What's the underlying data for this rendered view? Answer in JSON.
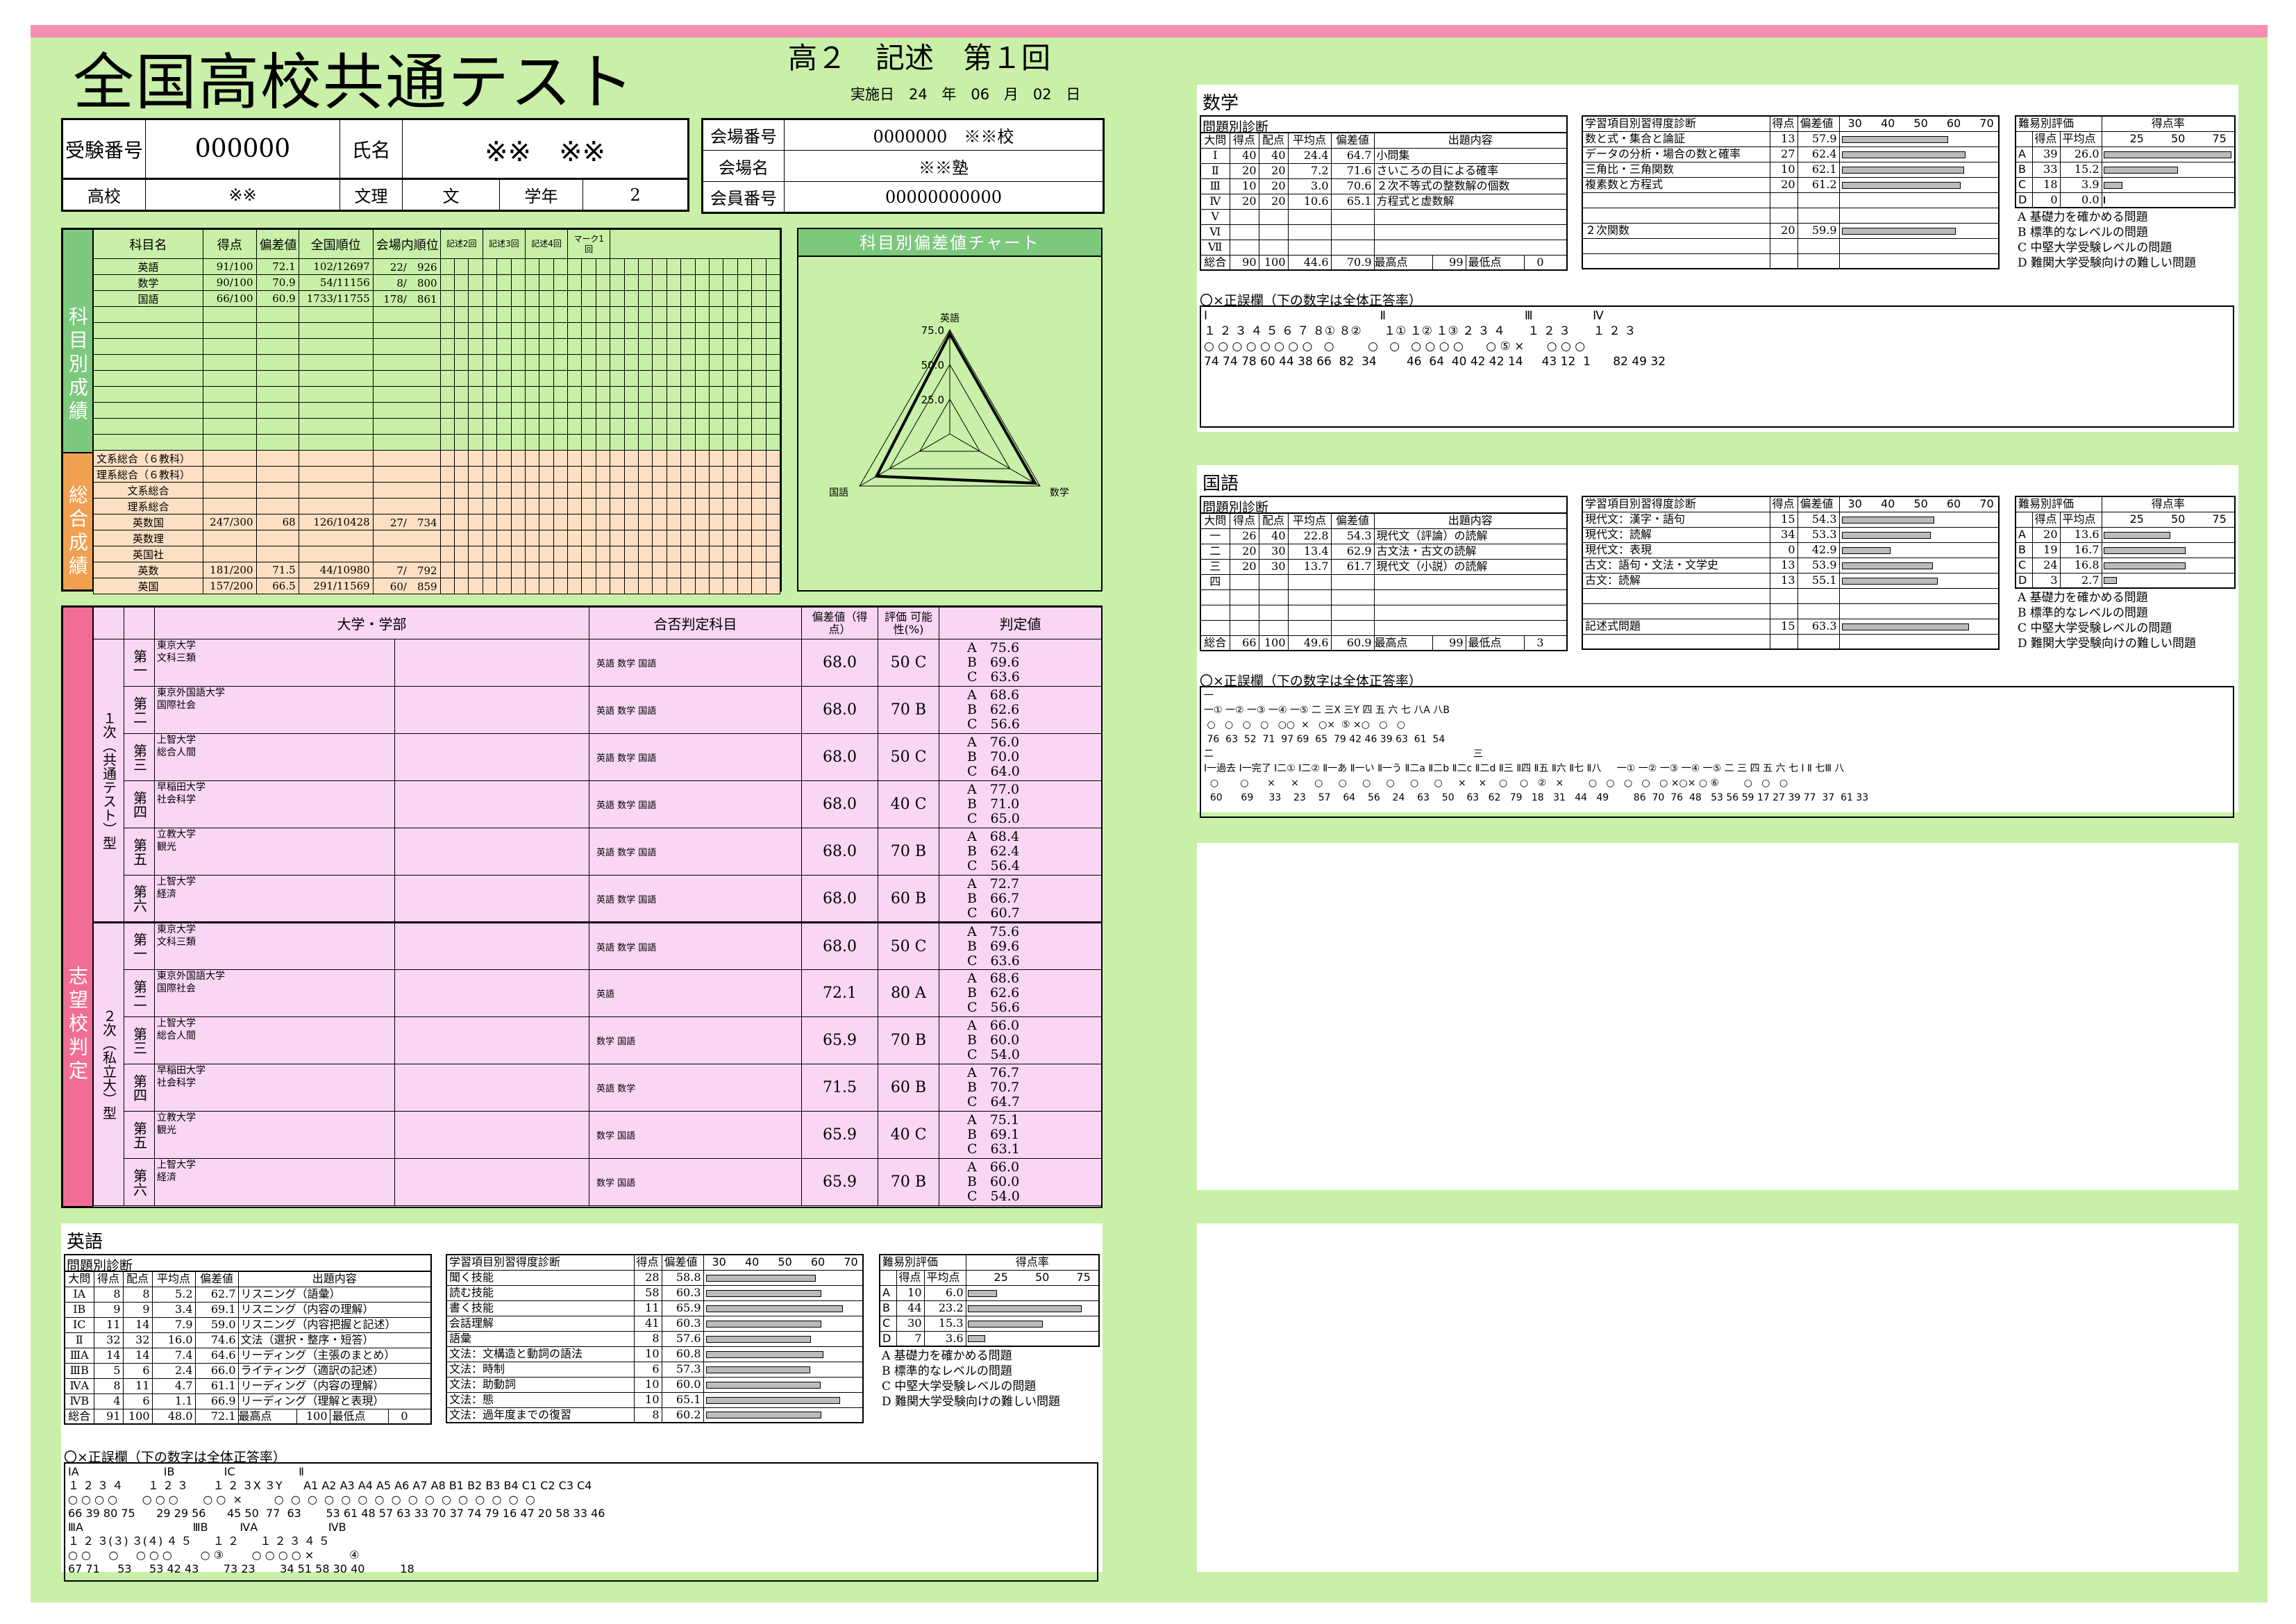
{
  "header": {
    "title": "全国高校共通テスト",
    "exam": "高２　記述　第１回",
    "date_label": "実施日",
    "date_year": "24 年",
    "date_month": "06 月",
    "date_day": "02 日"
  },
  "info": {
    "exam_no_label": "受験番号",
    "exam_no": "000000",
    "name_label": "氏名",
    "name": "※※　※※",
    "school_label": "高校",
    "school": "※※",
    "track_label": "文理",
    "track": "文",
    "grade_label": "学年",
    "grade": "2",
    "venue_no_label": "会場番号",
    "venue_no": "0000000　※※校",
    "venue_name_label": "会場名",
    "venue_name": "※※塾",
    "member_no_label": "会員番号",
    "member_no": "00000000000"
  },
  "scores": {
    "side_label": "科目別成績",
    "total_side_label": "総合成績",
    "headers": [
      "科目名",
      "得点",
      "偏差値",
      "全国順位",
      "会場内順位",
      "記述2回",
      "記述3回",
      "記述4回",
      "マーク1回"
    ],
    "rows": [
      {
        "subject": "英語",
        "score": "91/100",
        "dev": "72.1",
        "rank": "102/12697",
        "venue": "22/　926"
      },
      {
        "subject": "数学",
        "score": "90/100",
        "dev": "70.9",
        "rank": "54/11156",
        "venue": "8/　800"
      },
      {
        "subject": "国語",
        "score": "66/100",
        "dev": "60.9",
        "rank": "1733/11755",
        "venue": "178/　861"
      }
    ],
    "totals": [
      {
        "subject": "文系総合（６教科）",
        "score": "",
        "dev": "",
        "rank": "",
        "venue": ""
      },
      {
        "subject": "理系総合（６教科）",
        "score": "",
        "dev": "",
        "rank": "",
        "venue": ""
      },
      {
        "subject": "文系総合",
        "score": "",
        "dev": "",
        "rank": "",
        "venue": ""
      },
      {
        "subject": "理系総合",
        "score": "",
        "dev": "",
        "rank": "",
        "venue": ""
      },
      {
        "subject": "英数国",
        "score": "247/300",
        "dev": "68",
        "rank": "126/10428",
        "venue": "27/　734"
      },
      {
        "subject": "英数理",
        "score": "",
        "dev": "",
        "rank": "",
        "venue": ""
      },
      {
        "subject": "英国社",
        "score": "",
        "dev": "",
        "rank": "",
        "venue": ""
      },
      {
        "subject": "英数",
        "score": "181/200",
        "dev": "71.5",
        "rank": "44/10980",
        "venue": "7/　792"
      },
      {
        "subject": "英国",
        "score": "157/200",
        "dev": "66.5",
        "rank": "291/11569",
        "venue": "60/　859"
      }
    ]
  },
  "chart": {
    "title": "科目別偏差値チャート",
    "labels": [
      "英語",
      "数学",
      "国語"
    ],
    "ticks": [
      "75.0",
      "50.0",
      "25.0"
    ]
  },
  "chart_data": {
    "type": "radar",
    "categories": [
      "英語",
      "数学",
      "国語"
    ],
    "values": [
      72.1,
      70.9,
      60.9
    ],
    "rlim": [
      0,
      75
    ]
  },
  "judge": {
    "side_label": "志望校判定",
    "headers": [
      "大学・学部",
      "合否判定科目",
      "偏差値（得点）",
      "評価 可能性(%)",
      "判定値"
    ],
    "groups": [
      {
        "label": "１次（共通テスト）型",
        "rows": [
          {
            "rank": "第一",
            "univ": "東京大学",
            "dept": "文科三類",
            "subj": "英語 数学 国語",
            "dev": "68.0",
            "eval": "50 C",
            "j": [
              "A　75.6",
              "B　69.6",
              "C　63.6"
            ]
          },
          {
            "rank": "第二",
            "univ": "東京外国語大学",
            "dept": "国際社会",
            "subj": "英語 数学 国語",
            "dev": "68.0",
            "eval": "70 B",
            "j": [
              "A　68.6",
              "B　62.6",
              "C　56.6"
            ]
          },
          {
            "rank": "第三",
            "univ": "上智大学",
            "dept": "総合人間",
            "subj": "英語 数学 国語",
            "dev": "68.0",
            "eval": "50 C",
            "j": [
              "A　76.0",
              "B　70.0",
              "C　64.0"
            ]
          },
          {
            "rank": "第四",
            "univ": "早稲田大学",
            "dept": "社会科学",
            "subj": "英語 数学 国語",
            "dev": "68.0",
            "eval": "40 C",
            "j": [
              "A　77.0",
              "B　71.0",
              "C　65.0"
            ]
          },
          {
            "rank": "第五",
            "univ": "立教大学",
            "dept": "観光",
            "subj": "英語 数学 国語",
            "dev": "68.0",
            "eval": "70 B",
            "j": [
              "A　68.4",
              "B　62.4",
              "C　56.4"
            ]
          },
          {
            "rank": "第六",
            "univ": "上智大学",
            "dept": "経済",
            "subj": "英語 数学 国語",
            "dev": "68.0",
            "eval": "60 B",
            "j": [
              "A　72.7",
              "B　66.7",
              "C　60.7"
            ]
          }
        ]
      },
      {
        "label": "２次（私立大）型",
        "rows": [
          {
            "rank": "第一",
            "univ": "東京大学",
            "dept": "文科三類",
            "subj": "英語 数学 国語",
            "dev": "68.0",
            "eval": "50 C",
            "j": [
              "A　75.6",
              "B　69.6",
              "C　63.6"
            ]
          },
          {
            "rank": "第二",
            "univ": "東京外国語大学",
            "dept": "国際社会",
            "subj": "英語",
            "dev": "72.1",
            "eval": "80 A",
            "j": [
              "A　68.6",
              "B　62.6",
              "C　56.6"
            ]
          },
          {
            "rank": "第三",
            "univ": "上智大学",
            "dept": "総合人間",
            "subj": "数学 国語",
            "dev": "65.9",
            "eval": "70 B",
            "j": [
              "A　66.0",
              "B　60.0",
              "C　54.0"
            ]
          },
          {
            "rank": "第四",
            "univ": "早稲田大学",
            "dept": "社会科学",
            "subj": "英語 数学",
            "dev": "71.5",
            "eval": "60 B",
            "j": [
              "A　76.7",
              "B　70.7",
              "C　64.7"
            ]
          },
          {
            "rank": "第五",
            "univ": "立教大学",
            "dept": "観光",
            "subj": "数学 国語",
            "dev": "65.9",
            "eval": "40 C",
            "j": [
              "A　75.1",
              "B　69.1",
              "C　63.1"
            ]
          },
          {
            "rank": "第六",
            "univ": "上智大学",
            "dept": "経済",
            "subj": "数学 国語",
            "dev": "65.9",
            "eval": "70 B",
            "j": [
              "A　66.0",
              "B　60.0",
              "C　54.0"
            ]
          }
        ]
      }
    ]
  },
  "common": {
    "q_label": "問題別診断",
    "sk_label": "学習項目別習得度診断",
    "df_label": "難易別評価",
    "q_headers": [
      "大問",
      "得点",
      "配点",
      "平均点",
      "偏差値",
      "出題内容"
    ],
    "sk_headers": [
      "得点",
      "偏差値",
      "30",
      "40",
      "50",
      "60",
      "70"
    ],
    "df_headers": [
      "得点",
      "平均点",
      "得点率",
      "25",
      "50",
      "75"
    ],
    "total": "総合",
    "max": "最高点",
    "min": "最低点",
    "diff_notes": [
      "A 基礎力を確かめる問題",
      "B 標準的なレベルの問題",
      "C 中堅大学受験レベルの問題",
      "D 難関大学受験向けの難しい問題"
    ],
    "ox_title": "〇×正誤欄（下の数字は全体正答率）"
  },
  "math": {
    "title": "数学",
    "q": [
      [
        "Ⅰ",
        "40",
        "40",
        "24.4",
        "64.7",
        "小問集"
      ],
      [
        "Ⅱ",
        "20",
        "20",
        "7.2",
        "71.6",
        "さいころの目による確率"
      ],
      [
        "Ⅲ",
        "10",
        "20",
        "3.0",
        "70.6",
        "２次不等式の整数解の個数"
      ],
      [
        "Ⅳ",
        "20",
        "20",
        "10.6",
        "65.1",
        "方程式と虚数解"
      ],
      [
        "Ⅴ",
        "",
        "",
        "",
        "",
        ""
      ],
      [
        "Ⅵ",
        "",
        "",
        "",
        "",
        ""
      ],
      [
        "Ⅶ",
        "",
        "",
        "",
        "",
        ""
      ]
    ],
    "total": [
      "90",
      "100",
      "44.6",
      "70.9",
      "99",
      "0"
    ],
    "sk": [
      [
        "数と式・集合と論証",
        "13",
        "57.9",
        57.9
      ],
      [
        "データの分析・場合の数と確率",
        "27",
        "62.4",
        62.4
      ],
      [
        "三角比・三角関数",
        "10",
        "62.1",
        62.1
      ],
      [
        "複素数と方程式",
        "20",
        "61.2",
        61.2
      ],
      [
        "",
        "",
        "",
        0
      ],
      [
        "",
        "",
        "",
        0
      ],
      [
        "２次関数",
        "20",
        "59.9",
        59.9
      ],
      [
        "",
        "",
        "",
        0
      ],
      [
        "",
        "",
        "",
        0
      ]
    ],
    "df": [
      [
        "A",
        "39",
        "26.0",
        26.0
      ],
      [
        "B",
        "33",
        "15.2",
        15.2
      ],
      [
        "C",
        "18",
        "3.9",
        3.9
      ],
      [
        "D",
        "0",
        "0.0",
        0.0
      ]
    ],
    "ox": "Ⅰ                                              Ⅱ                                     Ⅲ                Ⅳ\n１ ２ ３ ４ ５ ６ ７ ８① ８②      １① １② １③ ２ ３ ４      １ ２ ３      １ ２ ３\n○ ○ ○ ○ ○ ○ ○ ○   ○         ○   ○   ○ ○ ○ ○      ○ ⑤ ×      ○ ○ ○\n74 74 78 60 44 38 66  82  34        46  64  40 42 42 14     43 12  1      82 49 32"
  },
  "japanese": {
    "title": "国語",
    "q": [
      [
        "一",
        "26",
        "40",
        "22.8",
        "54.3",
        "現代文（評論）の読解"
      ],
      [
        "二",
        "20",
        "30",
        "13.4",
        "62.9",
        "古文法・古文の読解"
      ],
      [
        "三",
        "20",
        "30",
        "13.7",
        "61.7",
        "現代文（小説）の読解"
      ],
      [
        "四",
        "",
        "",
        "",
        "",
        ""
      ],
      [
        "",
        "",
        "",
        "",
        "",
        ""
      ],
      [
        "",
        "",
        "",
        "",
        "",
        ""
      ],
      [
        "",
        "",
        "",
        "",
        "",
        ""
      ]
    ],
    "total": [
      "66",
      "100",
      "49.6",
      "60.9",
      "99",
      "3"
    ],
    "sk": [
      [
        "現代文：漢字・語句",
        "15",
        "54.3",
        54.3
      ],
      [
        "現代文：読解",
        "34",
        "53.3",
        53.3
      ],
      [
        "現代文：表現",
        "0",
        "42.9",
        42.9
      ],
      [
        "古文：語句・文法・文学史",
        "13",
        "53.9",
        53.9
      ],
      [
        "古文：読解",
        "13",
        "55.1",
        55.1
      ],
      [
        "",
        "",
        "",
        0
      ],
      [
        "",
        "",
        "",
        0
      ],
      [
        "記述式問題",
        "15",
        "63.3",
        63.3
      ],
      [
        "",
        "",
        "",
        0
      ]
    ],
    "df": [
      [
        "A",
        "20",
        "13.6",
        13.6
      ],
      [
        "B",
        "19",
        "16.7",
        16.7
      ],
      [
        "C",
        "24",
        "16.8",
        16.8
      ],
      [
        "D",
        "3",
        "2.7",
        2.7
      ]
    ],
    "ox": "一\n一① 一② 一③ 一④ 一⑤ 二 三X 三Y 四 五 六 七 八A 八B\n ○   ○   ○   ○   ○○  ×   ○×  ⑤ ×○   ○   ○\n 76  63  52  71  97 69  65  79 42 46 39 63  61  54\n二                                                                                    三\nⅠ一過去 Ⅰ一完了 Ⅰ二① Ⅰ二② Ⅱ一あ Ⅱ一い Ⅱ一う Ⅱ二a Ⅱ二b Ⅱ二c Ⅱ二d Ⅱ三 Ⅱ四 Ⅱ五 Ⅱ六 Ⅱ七 Ⅱ八     一① 一② 一③ 一④ 一⑤ 二 三 四 五 六 七 Ⅰ Ⅱ 七Ⅲ 八\n  ○       ○      ×     ×     ○     ○     ○     ○     ○     ○     ×    ×    ○    ○   ②   ×        ○   ○   ○   ○   ○ ×○× ○ ⑥        ○   ○   ○\n  60      69     33    23    57    64    56    24    63    50    63   62   79   18   31   44   49        86  70  76  48   53 56 59 17 27 39 77  37  61 33"
  },
  "english": {
    "title": "英語",
    "q": [
      [
        "ⅠA",
        "8",
        "8",
        "5.2",
        "62.7",
        "リスニング（語彙）"
      ],
      [
        "ⅠB",
        "9",
        "9",
        "3.4",
        "69.1",
        "リスニング（内容の理解）"
      ],
      [
        "ⅠC",
        "11",
        "14",
        "7.9",
        "59.0",
        "リスニング（内容把握と記述）"
      ],
      [
        "Ⅱ",
        "32",
        "32",
        "16.0",
        "74.6",
        "文法（選択・整序・短答）"
      ],
      [
        "ⅢA",
        "14",
        "14",
        "7.4",
        "64.6",
        "リーディング（主張のまとめ）"
      ],
      [
        "ⅢB",
        "5",
        "6",
        "2.4",
        "66.0",
        "ライティング（適訳の記述）"
      ],
      [
        "ⅣA",
        "8",
        "11",
        "4.7",
        "61.1",
        "リーディング（内容の理解）"
      ],
      [
        "ⅣB",
        "4",
        "6",
        "1.1",
        "66.9",
        "リーディング（理解と表現）"
      ]
    ],
    "total": [
      "91",
      "100",
      "48.0",
      "72.1",
      "100",
      "0"
    ],
    "sk": [
      [
        "聞く技能",
        "28",
        "58.8",
        58.8
      ],
      [
        "読む技能",
        "58",
        "60.3",
        60.3
      ],
      [
        "書く技能",
        "11",
        "65.9",
        65.9
      ],
      [
        "会話理解",
        "41",
        "60.3",
        60.3
      ],
      [
        "語彙",
        "8",
        "57.6",
        57.6
      ],
      [
        "文法：文構造と動詞の語法",
        "10",
        "60.8",
        60.8
      ],
      [
        "文法：時制",
        "6",
        "57.3",
        57.3
      ],
      [
        "文法：助動詞",
        "10",
        "60.0",
        60.0
      ],
      [
        "文法：態",
        "10",
        "65.1",
        65.1
      ],
      [
        "文法：過年度までの復習",
        "8",
        "60.2",
        60.2
      ]
    ],
    "df": [
      [
        "A",
        "10",
        "6.0",
        6.0
      ],
      [
        "B",
        "44",
        "23.2",
        23.2
      ],
      [
        "C",
        "30",
        "15.3",
        15.3
      ],
      [
        "D",
        "7",
        "3.6",
        3.6
      ]
    ],
    "ox": "ⅠA                        ⅠB              ⅠC                  Ⅱ\n１ ２ ３ ４       １ ２ ３       １ ２ ３X ３Y      A1 A2 A3 A4 A5 A6 A7 A8 B1 B2 B3 B4 C1 C2 C3 C4\n○ ○ ○ ○       ○ ○ ○       ○ ○  ×         ○  ○  ○  ○  ○  ○  ○  ○  ○  ○  ○  ○  ○  ○  ○  ○\n66 39 80 75      29 29 56      45 50  77  63       53 61 48 57 63 33 70 37 74 79 16 47 20 58 33 46\nⅢA                               ⅢB         ⅣA                    ⅣB\n１ ２ ３(３) ３(４) ４ ５      １ ２      １ ２ ３ ４ ５\n○ ○     ○     ○ ○ ○        ○ ③        ○ ○ ○ ○ ×          ④\n67 71     53     53 42 43       73 23       34 51 58 30 40          18"
  }
}
